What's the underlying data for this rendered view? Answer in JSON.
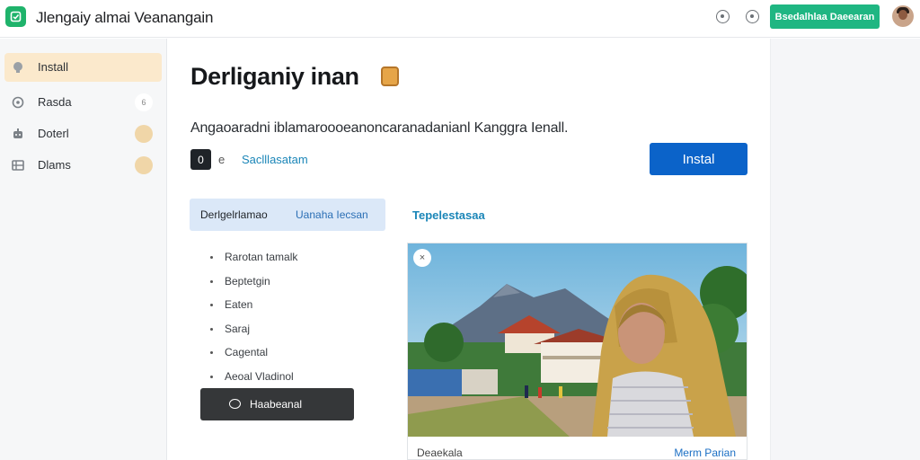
{
  "header": {
    "app_title": "Jlengaiy almai Veanangain",
    "cta_label": "Bsedalhlaa Daeearan",
    "colors": {
      "brand": "#1fb36b",
      "cta": "#1fb682"
    },
    "icons": [
      "app-logo-icon",
      "history-icon",
      "settings-icon"
    ]
  },
  "sidebar": {
    "items": [
      {
        "label": "Install",
        "icon": "install-icon",
        "active": true
      },
      {
        "label": "Rasda",
        "icon": "compass-icon"
      },
      {
        "label": "Doterl",
        "icon": "robot-icon"
      },
      {
        "label": "Dlams",
        "icon": "grid-icon"
      }
    ],
    "badge_text": "6"
  },
  "main": {
    "title": "Derliganiy inan",
    "subtitle": "Angaoaradni iblamaroooeanoncaranadanianl Kanggra Ienall.",
    "meta_symbol": "e",
    "meta_icon_text": "0",
    "meta_link": "Saclllasatam",
    "install_label": "Instal",
    "tabs": [
      {
        "label": "Derlgelrlamao",
        "sublabel": "Uanaha Iecsan",
        "active": true
      },
      {
        "label": "Tepelestasaa",
        "active": false
      }
    ],
    "features": [
      "Rarotan tamalk",
      "Beptetgin",
      "Eaten",
      "Saraj",
      "Cagental",
      "Aeoal Vladinol"
    ],
    "dark_button_label": "Haabeanal",
    "photo": {
      "close_symbol": "×",
      "caption": "Deaekala",
      "link": "Merm Parian"
    },
    "colors": {
      "primary": "#0b63c9",
      "tab_bg": "#dbe8f8",
      "link": "#1b86b8"
    }
  }
}
